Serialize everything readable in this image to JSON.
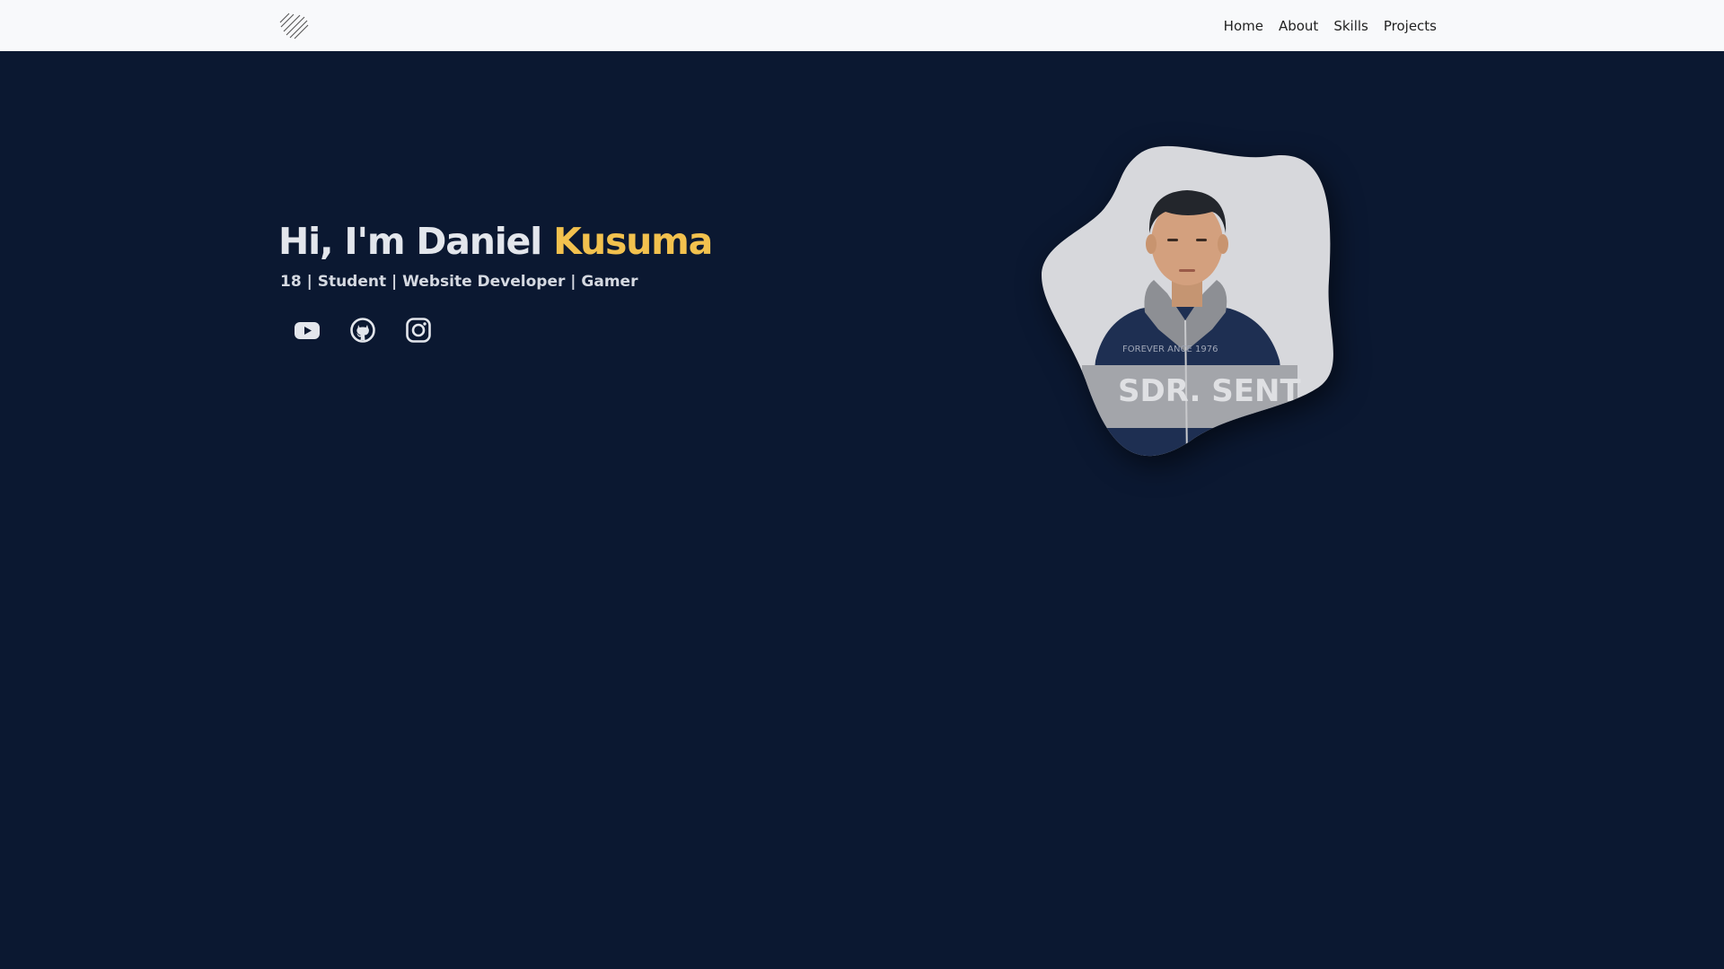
{
  "nav": {
    "logo_icon": "diagonal-lines-logo",
    "links": [
      "Home",
      "About",
      "Skills",
      "Projects"
    ]
  },
  "hero": {
    "greeting": "Hi, I'm Daniel ",
    "name_accent": "Kusuma",
    "subtitle": "18 | Student | Website Developer | Gamer",
    "socials": [
      "youtube-icon",
      "github-icon",
      "instagram-icon"
    ],
    "portrait_shirt_text": "SDR. SENT",
    "portrait_shirt_subtext": "FOREVER   ANCE 1976"
  },
  "colors": {
    "background": "#0b1831",
    "navbar": "#f8f9fb",
    "accent": "#f2c14e",
    "text": "#e3e6ec"
  }
}
